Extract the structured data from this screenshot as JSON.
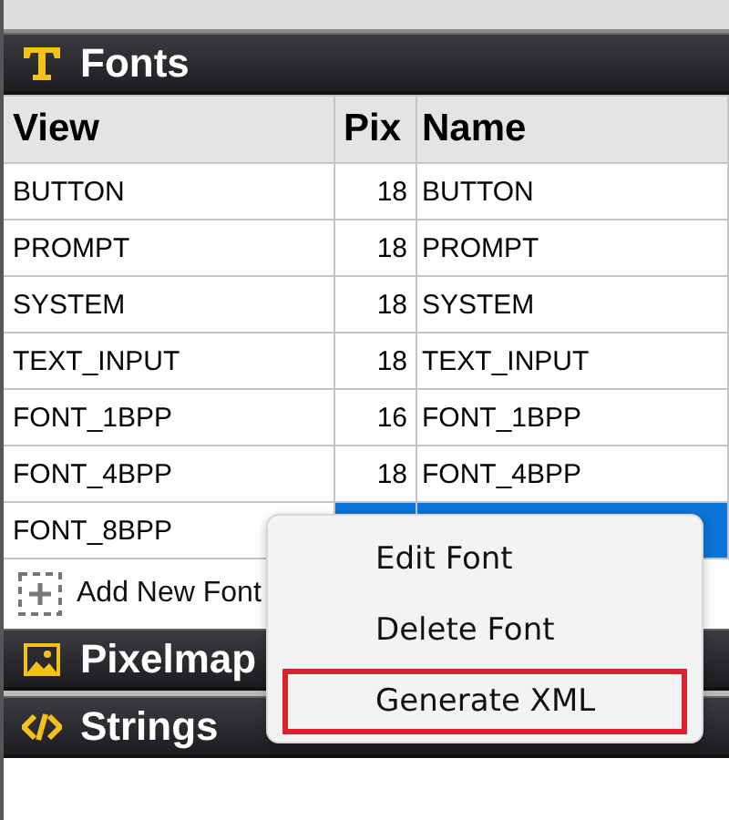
{
  "sections": [
    {
      "kind": "fonts",
      "title": "Fonts"
    },
    {
      "kind": "pixelmaps",
      "title": "Pixelmap"
    },
    {
      "kind": "strings",
      "title": "Strings"
    }
  ],
  "table": {
    "columns": [
      "View",
      "Pix",
      "Name"
    ],
    "rows": [
      {
        "view": "BUTTON",
        "pix": "18",
        "name": "BUTTON",
        "selected": false
      },
      {
        "view": "PROMPT",
        "pix": "18",
        "name": "PROMPT",
        "selected": false
      },
      {
        "view": "SYSTEM",
        "pix": "18",
        "name": "SYSTEM",
        "selected": false
      },
      {
        "view": "TEXT_INPUT",
        "pix": "18",
        "name": "TEXT_INPUT",
        "selected": false
      },
      {
        "view": "FONT_1BPP",
        "pix": "16",
        "name": "FONT_1BPP",
        "selected": false
      },
      {
        "view": "FONT_4BPP",
        "pix": "18",
        "name": "FONT_4BPP",
        "selected": false
      },
      {
        "view": "FONT_8BPP",
        "selected": true
      }
    ]
  },
  "add_button": "Add New Font",
  "context_menu": [
    {
      "label": "Edit Font",
      "highlighted": false
    },
    {
      "label": "Delete Font",
      "highlighted": false
    },
    {
      "label": "Generate XML",
      "highlighted": true
    }
  ]
}
